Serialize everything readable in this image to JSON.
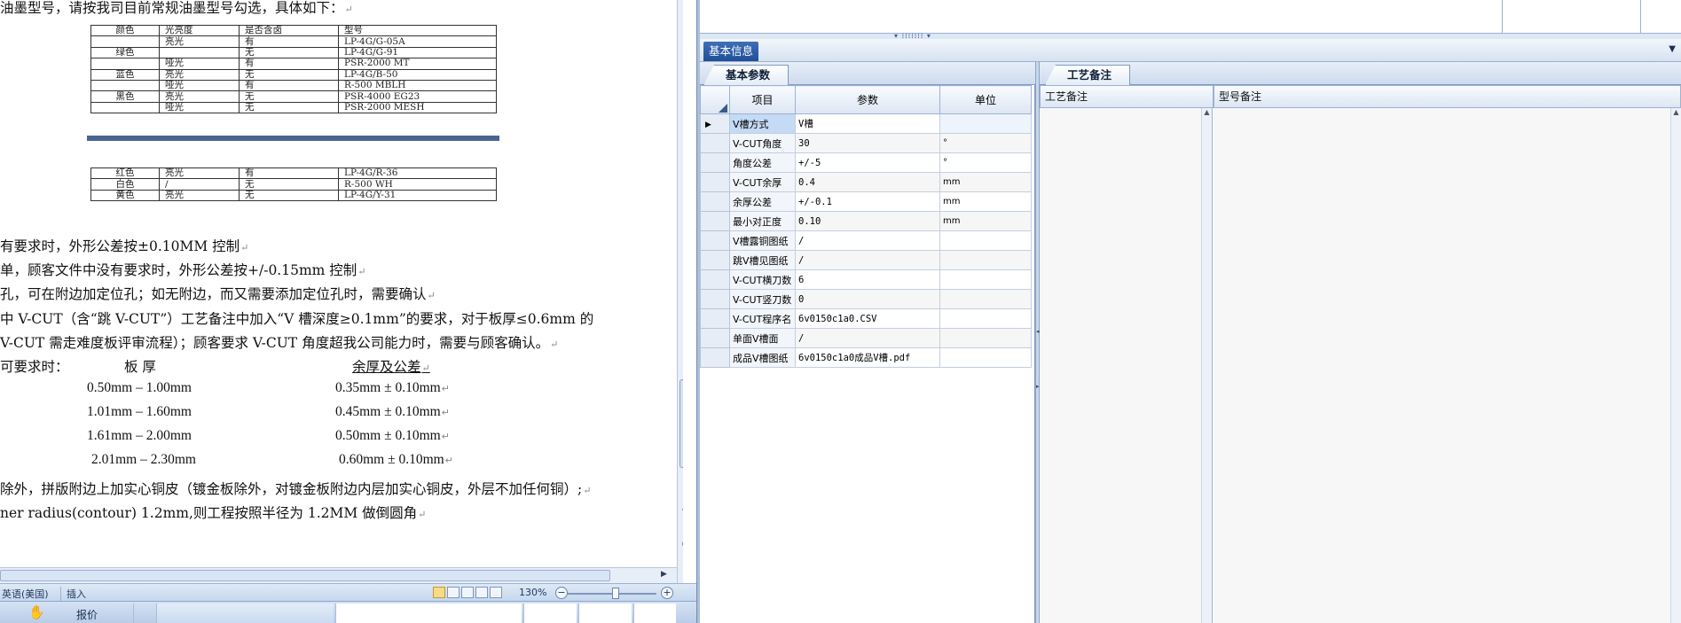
{
  "document": {
    "intro_line": "油墨型号，请按我司目前常规油墨型号勾选，具体如下：",
    "ink_table_1": {
      "headers": [
        "颜色",
        "光亮度",
        "是否含卤",
        "型号"
      ],
      "rows": [
        [
          "",
          "亮光",
          "有",
          "LP-4G/G-05A"
        ],
        [
          "绿色",
          "",
          "无",
          "LP-4G/G-91"
        ],
        [
          "",
          "哑光",
          "有",
          "PSR-2000 MT"
        ],
        [
          "蓝色",
          "亮光",
          "无",
          "LP-4G/B-50"
        ],
        [
          "",
          "哑光",
          "有",
          "R-500 MBLH"
        ],
        [
          "黑色",
          "亮光",
          "无",
          "PSR-4000 EG23"
        ],
        [
          "",
          "哑光",
          "无",
          "PSR-2000 MESH"
        ]
      ]
    },
    "ink_table_2": {
      "rows": [
        [
          "红色",
          "亮光",
          "有",
          "LP-4G/R-36"
        ],
        [
          "白色",
          "/",
          "无",
          "R-500 WH"
        ],
        [
          "黄色",
          "亮光",
          "无",
          "LP-4G/Y-31"
        ]
      ]
    },
    "lines": [
      "有要求时，外形公差按±0.10MM 控制",
      "单，顾客文件中没有要求时，外形公差按+/-0.15mm 控制",
      "孔，可在附边加定位孔；如无附边，而又需要添加定位孔时，需要确认",
      "中 V-CUT（含“跳 V-CUT”）工艺备注中加入“V 槽深度≥0.1mm”的要求，对于板厚≤0.6mm 的",
      "V-CUT 需走难度板评审流程）；顾客要求 V-CUT 角度超我公司能力时，需要与顾客确认。"
    ],
    "thickness_heading": {
      "prefix": "可要求时：",
      "col1": "板  厚",
      "col2": "余厚及公差"
    },
    "thickness_rows": [
      [
        "0.50mm – 1.00mm",
        "0.35mm ± 0.10mm"
      ],
      [
        "1.01mm – 1.60mm",
        "0.45mm ± 0.10mm"
      ],
      [
        "1.61mm – 2.00mm",
        "0.50mm ± 0.10mm"
      ],
      [
        "2.01mm – 2.30mm",
        "0.60mm ± 0.10mm"
      ]
    ],
    "tail_lines": [
      "除外，拼版附边上加实心铜皮（镀金板除外，对镀金板附边内层加实心铜皮，外层不加任何铜）;",
      "ner radius(contour)  1.2mm,则工程按照半径为 1.2MM 做倒圆角"
    ]
  },
  "statusbar": {
    "language": "英语(美国)",
    "mode": "插入",
    "zoom": "130%",
    "zoom_minus": "−",
    "zoom_plus": "+"
  },
  "taskbar": {
    "item": "报价"
  },
  "app": {
    "section_title": "基本信息",
    "tab_params": "基本参数",
    "tab_remarks": "工艺备注",
    "grid_headers": {
      "item": "项目",
      "param": "参数",
      "unit": "单位"
    },
    "grid_rows": [
      {
        "item": "V槽方式",
        "param": "V槽",
        "unit": ""
      },
      {
        "item": "V-CUT角度",
        "param": "30",
        "unit": "°"
      },
      {
        "item": "角度公差",
        "param": "+/-5",
        "unit": "°"
      },
      {
        "item": "V-CUT余厚",
        "param": "0.4",
        "unit": "mm"
      },
      {
        "item": "余厚公差",
        "param": "+/-0.1",
        "unit": "mm"
      },
      {
        "item": "最小对正度",
        "param": "0.10",
        "unit": "mm"
      },
      {
        "item": "V槽露铜图纸",
        "param": "/",
        "unit": ""
      },
      {
        "item": "跳V槽见图纸",
        "param": "/",
        "unit": ""
      },
      {
        "item": "V-CUT横刀数",
        "param": "6",
        "unit": ""
      },
      {
        "item": "V-CUT竖刀数",
        "param": "0",
        "unit": ""
      },
      {
        "item": "V-CUT程序名",
        "param": "6v0150c1a0.CSV",
        "unit": ""
      },
      {
        "item": "单面V槽面",
        "param": "/",
        "unit": ""
      },
      {
        "item": "成品V槽图纸",
        "param": "6v0150c1a0成品V槽.pdf",
        "unit": ""
      }
    ],
    "remark_headers": {
      "process": "工艺备注",
      "model": "型号备注"
    }
  }
}
